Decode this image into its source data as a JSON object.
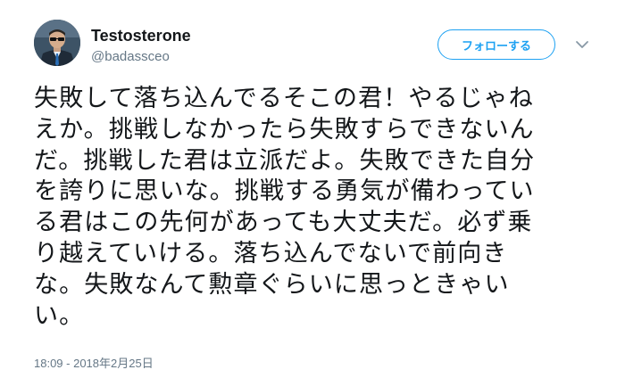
{
  "user": {
    "display_name": "Testosterone",
    "handle": "@badassceo"
  },
  "follow_button": {
    "label": "フォローする"
  },
  "tweet": {
    "lines": [
      "失敗して落ち込んでるそこの君！やるじゃね",
      "えか。挑戦しなかったら失敗すらできないん",
      "だ。挑戦した君は立派だよ。失敗できた自分",
      "を誇りに思いな。挑戦する勇気が備わってい",
      "る君はこの先何があっても大丈夫だ。必ず乗",
      "り越えていける。落ち込んでないで前向き",
      "な。失敗なんて勲章ぐらいに思っときゃい",
      "い。"
    ],
    "timestamp": "18:09 - 2018年2月25日"
  },
  "colors": {
    "accent": "#1da1f2",
    "text": "#14171a",
    "secondary": "#657786"
  },
  "icons": {
    "avatar": "profile-photo",
    "menu": "chevron-down-icon"
  }
}
